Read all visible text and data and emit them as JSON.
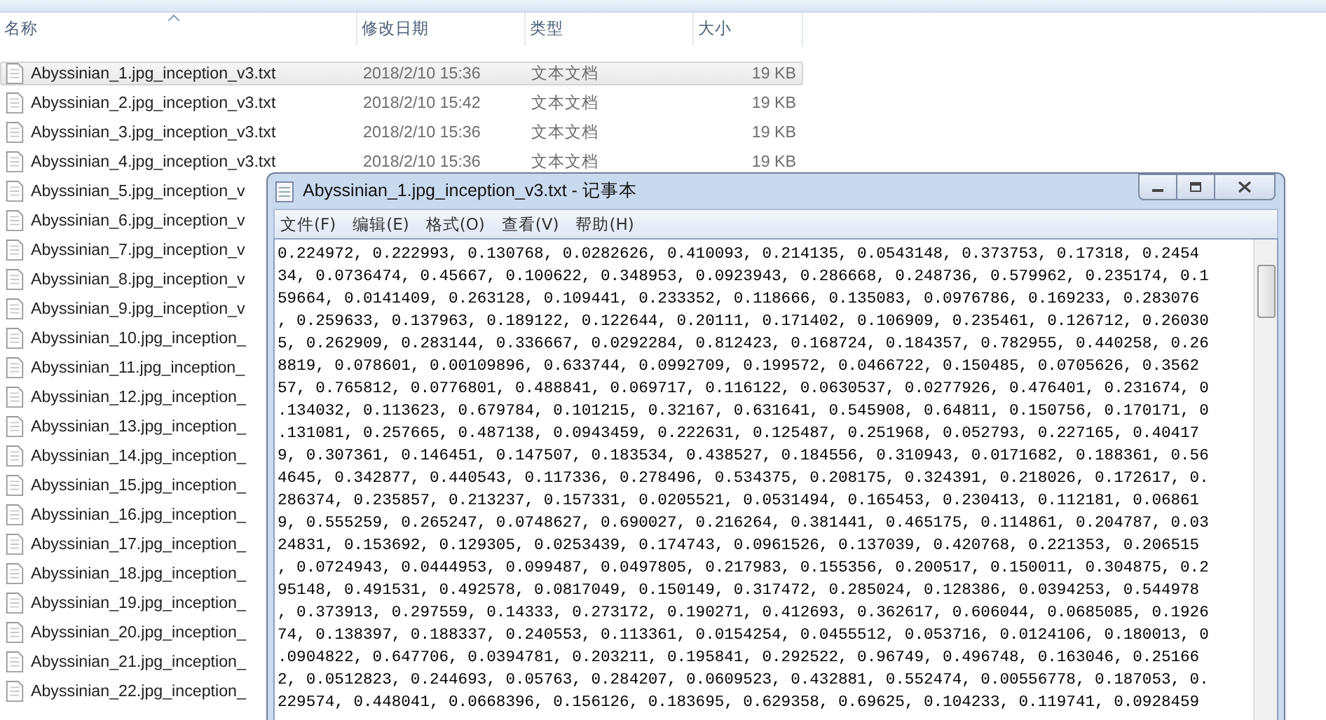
{
  "explorer": {
    "columns": [
      "名称",
      "修改日期",
      "类型",
      "大小"
    ],
    "files": [
      {
        "name": "Abyssinian_1.jpg_inception_v3.txt",
        "date": "2018/2/10 15:36",
        "type": "文本文档",
        "size": "19 KB",
        "selected": true
      },
      {
        "name": "Abyssinian_2.jpg_inception_v3.txt",
        "date": "2018/2/10 15:42",
        "type": "文本文档",
        "size": "19 KB",
        "selected": false
      },
      {
        "name": "Abyssinian_3.jpg_inception_v3.txt",
        "date": "2018/2/10 15:36",
        "type": "文本文档",
        "size": "19 KB",
        "selected": false
      },
      {
        "name": "Abyssinian_4.jpg_inception_v3.txt",
        "date": "2018/2/10 15:36",
        "type": "文本文档",
        "size": "19 KB",
        "selected": false
      },
      {
        "name": "Abyssinian_5.jpg_inception_v",
        "selected": false
      },
      {
        "name": "Abyssinian_6.jpg_inception_v",
        "selected": false
      },
      {
        "name": "Abyssinian_7.jpg_inception_v",
        "selected": false
      },
      {
        "name": "Abyssinian_8.jpg_inception_v",
        "selected": false
      },
      {
        "name": "Abyssinian_9.jpg_inception_v",
        "selected": false
      },
      {
        "name": "Abyssinian_10.jpg_inception_",
        "selected": false
      },
      {
        "name": "Abyssinian_11.jpg_inception_",
        "selected": false
      },
      {
        "name": "Abyssinian_12.jpg_inception_",
        "selected": false
      },
      {
        "name": "Abyssinian_13.jpg_inception_",
        "selected": false
      },
      {
        "name": "Abyssinian_14.jpg_inception_",
        "selected": false
      },
      {
        "name": "Abyssinian_15.jpg_inception_",
        "selected": false
      },
      {
        "name": "Abyssinian_16.jpg_inception_",
        "selected": false
      },
      {
        "name": "Abyssinian_17.jpg_inception_",
        "selected": false
      },
      {
        "name": "Abyssinian_18.jpg_inception_",
        "selected": false
      },
      {
        "name": "Abyssinian_19.jpg_inception_",
        "selected": false
      },
      {
        "name": "Abyssinian_20.jpg_inception_",
        "selected": false
      },
      {
        "name": "Abyssinian_21.jpg_inception_",
        "selected": false
      },
      {
        "name": "Abyssinian_22.jpg_inception_",
        "selected": false
      }
    ]
  },
  "notepad": {
    "title": "Abyssinian_1.jpg_inception_v3.txt - 记事本",
    "menu": [
      "文件(F)",
      "编辑(E)",
      "格式(O)",
      "查看(V)",
      "帮助(H)"
    ],
    "lines": [
      "0.224972, 0.222993, 0.130768, 0.0282626, 0.410093, 0.214135, 0.0543148, 0.373753, 0.17318, 0.2454",
      "34, 0.0736474, 0.45667, 0.100622, 0.348953, 0.0923943, 0.286668, 0.248736, 0.579962, 0.235174, 0.1",
      "59664, 0.0141409, 0.263128, 0.109441, 0.233352, 0.118666, 0.135083, 0.0976786, 0.169233, 0.283076",
      ", 0.259633, 0.137963, 0.189122, 0.122644, 0.20111, 0.171402, 0.106909, 0.235461, 0.126712, 0.26030",
      "5, 0.262909, 0.283144, 0.336667, 0.0292284, 0.812423, 0.168724, 0.184357, 0.782955, 0.440258, 0.26",
      "8819, 0.078601, 0.00109896, 0.633744, 0.0992709, 0.199572, 0.0466722, 0.150485, 0.0705626, 0.3562",
      "57, 0.765812, 0.0776801, 0.488841, 0.069717, 0.116122, 0.0630537, 0.0277926, 0.476401, 0.231674, 0",
      ".134032, 0.113623, 0.679784, 0.101215, 0.32167, 0.631641, 0.545908, 0.64811, 0.150756, 0.170171, 0",
      ".131081, 0.257665, 0.487138, 0.0943459, 0.222631, 0.125487, 0.251968, 0.052793, 0.227165, 0.40417",
      "9, 0.307361, 0.146451, 0.147507, 0.183534, 0.438527, 0.184556, 0.310943, 0.0171682, 0.188361, 0.56",
      "4645, 0.342877, 0.440543, 0.117336, 0.278496, 0.534375, 0.208175, 0.324391, 0.218026, 0.172617, 0.",
      "286374, 0.235857, 0.213237, 0.157331, 0.0205521, 0.0531494, 0.165453, 0.230413, 0.112181, 0.06861",
      "9, 0.555259, 0.265247, 0.0748627, 0.690027, 0.216264, 0.381441, 0.465175, 0.114861, 0.204787, 0.03",
      "24831, 0.153692, 0.129305, 0.0253439, 0.174743, 0.0961526, 0.137039, 0.420768, 0.221353, 0.206515",
      ", 0.0724943, 0.0444953, 0.099487, 0.0497805, 0.217983, 0.155356, 0.200517, 0.150011, 0.304875, 0.2",
      "95148, 0.491531, 0.492578, 0.0817049, 0.150149, 0.317472, 0.285024, 0.128386, 0.0394253, 0.544978",
      ", 0.373913, 0.297559, 0.14333, 0.273172, 0.190271, 0.412693, 0.362617, 0.606044, 0.0685085, 0.1926",
      "74, 0.138397, 0.188337, 0.240553, 0.113361, 0.0154254, 0.0455512, 0.053716, 0.0124106, 0.180013, 0",
      ".0904822, 0.647706, 0.0394781, 0.203211, 0.195841, 0.292522, 0.96749, 0.496748, 0.163046, 0.25166",
      "2, 0.0512823, 0.244693, 0.05763, 0.284207, 0.0609523, 0.432881, 0.552474, 0.00556778, 0.187053, 0.",
      "229574, 0.448041, 0.0668396, 0.156126, 0.183695, 0.629358, 0.69625, 0.104233, 0.119741, 0.0928459"
    ]
  }
}
